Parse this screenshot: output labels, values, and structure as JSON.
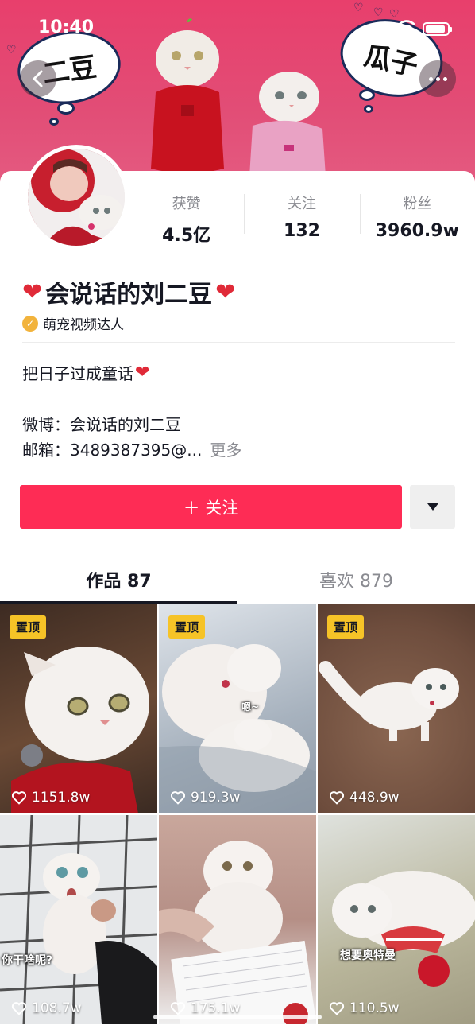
{
  "status_bar": {
    "time": "10:40"
  },
  "banner": {
    "bubble_left": "二豆",
    "bubble_right": "瓜子",
    "back_icon": "chevron-left-icon",
    "more_icon": "ellipsis-icon"
  },
  "profile": {
    "stats": [
      {
        "label": "获赞",
        "value": "4.5亿"
      },
      {
        "label": "关注",
        "value": "132"
      },
      {
        "label": "粉丝",
        "value": "3960.9w"
      }
    ],
    "name": "会说话的刘二豆",
    "verify_label": "萌宠视频达人",
    "bio": "把日子过成童话",
    "weibo": "微博：会说话的刘二豆",
    "email": "邮箱：3489387395@...",
    "more_label": "更多",
    "follow_label": "＋ 关注"
  },
  "tabs": [
    {
      "label": "作品 87",
      "active": true
    },
    {
      "label": "喜欢 879",
      "active": false
    }
  ],
  "videos": [
    {
      "pinned": "置顶",
      "likes": "1151.8w"
    },
    {
      "pinned": "置顶",
      "likes": "919.3w",
      "caption": "嗯~"
    },
    {
      "pinned": "置顶",
      "likes": "448.9w"
    },
    {
      "likes": "108.7w",
      "caption": "你干啥呢?"
    },
    {
      "likes": "175.1w"
    },
    {
      "likes": "110.5w",
      "caption": "想要奥特曼"
    }
  ],
  "colors": {
    "accent": "#fe2c55",
    "banner": "#e83f6c",
    "pin": "#f6c327"
  }
}
